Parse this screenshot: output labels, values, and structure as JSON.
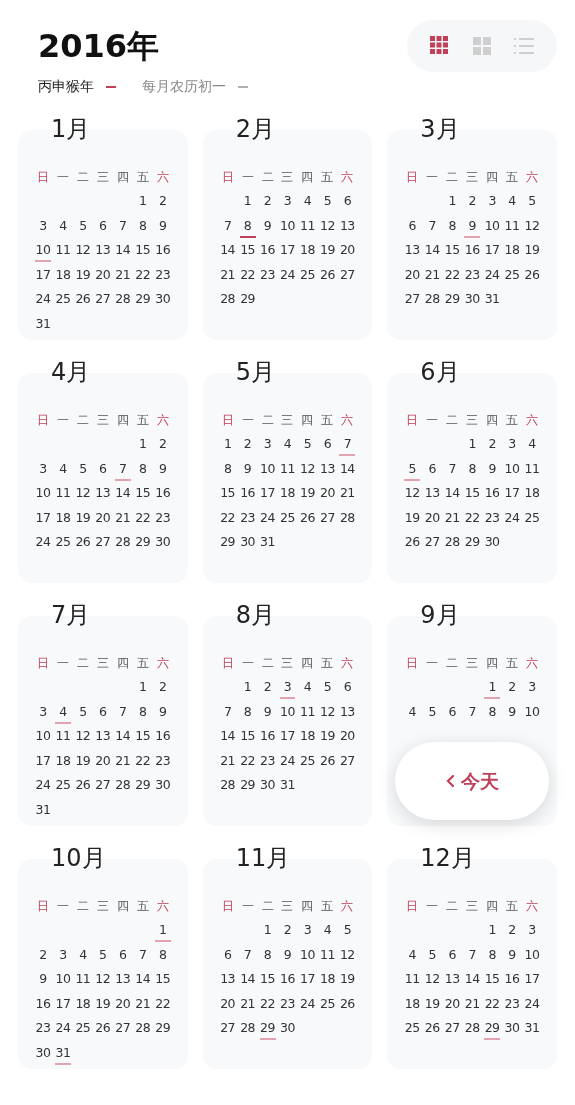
{
  "header": {
    "year": "2016年",
    "legend": [
      {
        "label": "丙申猴年",
        "color": "#c0405a"
      },
      {
        "label": "每月农历初一",
        "color": "#b0b0b0"
      }
    ]
  },
  "view_options": [
    {
      "kind": "month_grid",
      "selected": true
    },
    {
      "kind": "quad_grid",
      "selected": false
    },
    {
      "kind": "list",
      "selected": false
    }
  ],
  "months": [
    {
      "title": "1月",
      "weekdays": [
        {
          "label": "日",
          "weekend": true
        },
        {
          "label": "一",
          "weekend": false
        },
        {
          "label": "二",
          "weekend": false
        },
        {
          "label": "三",
          "weekend": false
        },
        {
          "label": "四",
          "weekend": false
        },
        {
          "label": "五",
          "weekend": false
        },
        {
          "label": "六",
          "weekend": true
        }
      ],
      "weeks": [
        {
          "kind": "first",
          "days": [
            "1",
            "2"
          ]
        },
        {
          "kind": "full",
          "days": [
            "3",
            "4",
            "5",
            "6",
            "7",
            "8",
            "9"
          ]
        },
        {
          "kind": "full",
          "days": [
            {
              "d": "10",
              "color": "#e3a3ae"
            },
            "11",
            "12",
            "13",
            "14",
            "15",
            "16"
          ]
        },
        {
          "kind": "full",
          "days": [
            "17",
            "18",
            "19",
            "20",
            "21",
            "22",
            "23"
          ]
        },
        {
          "kind": "full",
          "days": [
            "24",
            "25",
            "26",
            "27",
            "28",
            "29",
            "30"
          ]
        },
        {
          "kind": "last",
          "days": [
            "31"
          ]
        }
      ]
    },
    {
      "title": "2月",
      "weekdays": [
        {
          "label": "日",
          "weekend": true
        },
        {
          "label": "一",
          "weekend": false
        },
        {
          "label": "二",
          "weekend": false
        },
        {
          "label": "三",
          "weekend": false
        },
        {
          "label": "四",
          "weekend": false
        },
        {
          "label": "五",
          "weekend": false
        },
        {
          "label": "六",
          "weekend": true
        }
      ],
      "weeks": [
        {
          "kind": "first",
          "days": [
            "1",
            "2",
            "3",
            "4",
            "5",
            "6"
          ]
        },
        {
          "kind": "full",
          "days": [
            "7",
            {
              "d": "8",
              "color": "#c0405a"
            },
            "9",
            "10",
            "11",
            "12",
            "13"
          ]
        },
        {
          "kind": "full",
          "days": [
            "14",
            "15",
            "16",
            "17",
            "18",
            "19",
            "20"
          ]
        },
        {
          "kind": "full",
          "days": [
            "21",
            "22",
            "23",
            "24",
            "25",
            "26",
            "27"
          ]
        },
        {
          "kind": "last",
          "days": [
            "28",
            "29"
          ]
        }
      ]
    },
    {
      "title": "3月",
      "weekdays": [
        {
          "label": "日",
          "weekend": true
        },
        {
          "label": "一",
          "weekend": false
        },
        {
          "label": "二",
          "weekend": false
        },
        {
          "label": "三",
          "weekend": false
        },
        {
          "label": "四",
          "weekend": false
        },
        {
          "label": "五",
          "weekend": false
        },
        {
          "label": "六",
          "weekend": true
        }
      ],
      "weeks": [
        {
          "kind": "first",
          "days": [
            "1",
            "2",
            "3",
            "4",
            "5"
          ]
        },
        {
          "kind": "full",
          "days": [
            "6",
            "7",
            "8",
            {
              "d": "9",
              "color": "#e3a3ae"
            },
            "10",
            "11",
            "12"
          ]
        },
        {
          "kind": "full",
          "days": [
            "13",
            "14",
            "15",
            "16",
            "17",
            "18",
            "19"
          ]
        },
        {
          "kind": "full",
          "days": [
            "20",
            "21",
            "22",
            "23",
            "24",
            "25",
            "26"
          ]
        },
        {
          "kind": "last",
          "days": [
            "27",
            "28",
            "29",
            "30",
            "31"
          ]
        }
      ]
    },
    {
      "title": "4月",
      "weekdays": [
        {
          "label": "日",
          "weekend": true
        },
        {
          "label": "一",
          "weekend": false
        },
        {
          "label": "二",
          "weekend": false
        },
        {
          "label": "三",
          "weekend": false
        },
        {
          "label": "四",
          "weekend": false
        },
        {
          "label": "五",
          "weekend": false
        },
        {
          "label": "六",
          "weekend": true
        }
      ],
      "weeks": [
        {
          "kind": "first",
          "days": [
            "1",
            "2"
          ]
        },
        {
          "kind": "full",
          "days": [
            "3",
            "4",
            "5",
            "6",
            {
              "d": "7",
              "color": "#e3a3ae"
            },
            "8",
            "9"
          ]
        },
        {
          "kind": "full",
          "days": [
            "10",
            "11",
            "12",
            "13",
            "14",
            "15",
            "16"
          ]
        },
        {
          "kind": "full",
          "days": [
            "17",
            "18",
            "19",
            "20",
            "21",
            "22",
            "23"
          ]
        },
        {
          "kind": "full",
          "days": [
            "24",
            "25",
            "26",
            "27",
            "28",
            "29",
            "30"
          ]
        }
      ]
    },
    {
      "title": "5月",
      "weekdays": [
        {
          "label": "日",
          "weekend": true
        },
        {
          "label": "一",
          "weekend": false
        },
        {
          "label": "二",
          "weekend": false
        },
        {
          "label": "三",
          "weekend": false
        },
        {
          "label": "四",
          "weekend": false
        },
        {
          "label": "五",
          "weekend": false
        },
        {
          "label": "六",
          "weekend": true
        }
      ],
      "weeks": [
        {
          "kind": "full",
          "days": [
            "1",
            "2",
            "3",
            "4",
            "5",
            "6",
            {
              "d": "7",
              "color": "#e3a3ae"
            }
          ]
        },
        {
          "kind": "full",
          "days": [
            "8",
            "9",
            "10",
            "11",
            "12",
            "13",
            "14"
          ]
        },
        {
          "kind": "full",
          "days": [
            "15",
            "16",
            "17",
            "18",
            "19",
            "20",
            "21"
          ]
        },
        {
          "kind": "full",
          "days": [
            "22",
            "23",
            "24",
            "25",
            "26",
            "27",
            "28"
          ]
        },
        {
          "kind": "last",
          "days": [
            "29",
            "30",
            "31"
          ]
        }
      ]
    },
    {
      "title": "6月",
      "weekdays": [
        {
          "label": "日",
          "weekend": true
        },
        {
          "label": "一",
          "weekend": false
        },
        {
          "label": "二",
          "weekend": false
        },
        {
          "label": "三",
          "weekend": false
        },
        {
          "label": "四",
          "weekend": false
        },
        {
          "label": "五",
          "weekend": false
        },
        {
          "label": "六",
          "weekend": true
        }
      ],
      "weeks": [
        {
          "kind": "first",
          "days": [
            "1",
            "2",
            "3",
            "4"
          ]
        },
        {
          "kind": "full",
          "days": [
            {
              "d": "5",
              "color": "#e3a3ae"
            },
            "6",
            "7",
            "8",
            "9",
            "10",
            "11"
          ]
        },
        {
          "kind": "full",
          "days": [
            "12",
            "13",
            "14",
            "15",
            "16",
            "17",
            "18"
          ]
        },
        {
          "kind": "full",
          "days": [
            "19",
            "20",
            "21",
            "22",
            "23",
            "24",
            "25"
          ]
        },
        {
          "kind": "last",
          "days": [
            "26",
            "27",
            "28",
            "29",
            "30"
          ]
        }
      ]
    },
    {
      "title": "7月",
      "weekdays": [
        {
          "label": "日",
          "weekend": true
        },
        {
          "label": "一",
          "weekend": false
        },
        {
          "label": "二",
          "weekend": false
        },
        {
          "label": "三",
          "weekend": false
        },
        {
          "label": "四",
          "weekend": false
        },
        {
          "label": "五",
          "weekend": false
        },
        {
          "label": "六",
          "weekend": true
        }
      ],
      "weeks": [
        {
          "kind": "first",
          "days": [
            "1",
            "2"
          ]
        },
        {
          "kind": "full",
          "days": [
            "3",
            {
              "d": "4",
              "color": "#e3a3ae"
            },
            "5",
            "6",
            "7",
            "8",
            "9"
          ]
        },
        {
          "kind": "full",
          "days": [
            "10",
            "11",
            "12",
            "13",
            "14",
            "15",
            "16"
          ]
        },
        {
          "kind": "full",
          "days": [
            "17",
            "18",
            "19",
            "20",
            "21",
            "22",
            "23"
          ]
        },
        {
          "kind": "full",
          "days": [
            "24",
            "25",
            "26",
            "27",
            "28",
            "29",
            "30"
          ]
        },
        {
          "kind": "last",
          "days": [
            "31"
          ]
        }
      ]
    },
    {
      "title": "8月",
      "weekdays": [
        {
          "label": "日",
          "weekend": true
        },
        {
          "label": "一",
          "weekend": false
        },
        {
          "label": "二",
          "weekend": false
        },
        {
          "label": "三",
          "weekend": false
        },
        {
          "label": "四",
          "weekend": false
        },
        {
          "label": "五",
          "weekend": false
        },
        {
          "label": "六",
          "weekend": true
        }
      ],
      "weeks": [
        {
          "kind": "first",
          "days": [
            "1",
            "2",
            {
              "d": "3",
              "color": "#e3a3ae"
            },
            "4",
            "5",
            "6"
          ]
        },
        {
          "kind": "full",
          "days": [
            "7",
            "8",
            "9",
            "10",
            "11",
            "12",
            "13"
          ]
        },
        {
          "kind": "full",
          "days": [
            "14",
            "15",
            "16",
            "17",
            "18",
            "19",
            "20"
          ]
        },
        {
          "kind": "full",
          "days": [
            "21",
            "22",
            "23",
            "24",
            "25",
            "26",
            "27"
          ]
        },
        {
          "kind": "last",
          "days": [
            "28",
            "29",
            "30",
            "31"
          ]
        }
      ]
    },
    {
      "title": "9月",
      "weekdays": [
        {
          "label": "日",
          "weekend": true
        },
        {
          "label": "一",
          "weekend": false
        },
        {
          "label": "二",
          "weekend": false
        },
        {
          "label": "三",
          "weekend": false
        },
        {
          "label": "四",
          "weekend": false
        },
        {
          "label": "五",
          "weekend": false
        },
        {
          "label": "六",
          "weekend": true
        }
      ],
      "weeks": [
        {
          "kind": "first",
          "days": [
            {
              "d": "1",
              "color": "#e3a3ae"
            },
            "2",
            "3"
          ]
        },
        {
          "kind": "full",
          "days": [
            "4",
            "5",
            "6",
            "7",
            "8",
            "9",
            "10"
          ]
        }
      ]
    },
    {
      "title": "10月",
      "weekdays": [
        {
          "label": "日",
          "weekend": true
        },
        {
          "label": "一",
          "weekend": false
        },
        {
          "label": "二",
          "weekend": false
        },
        {
          "label": "三",
          "weekend": false
        },
        {
          "label": "四",
          "weekend": false
        },
        {
          "label": "五",
          "weekend": false
        },
        {
          "label": "六",
          "weekend": true
        }
      ],
      "weeks": [
        {
          "kind": "first",
          "days": [
            {
              "d": "1",
              "color": "#e3a3ae"
            }
          ]
        },
        {
          "kind": "full",
          "days": [
            "2",
            "3",
            "4",
            "5",
            "6",
            "7",
            "8"
          ]
        },
        {
          "kind": "full",
          "days": [
            "9",
            "10",
            "11",
            "12",
            "13",
            "14",
            "15"
          ]
        },
        {
          "kind": "full",
          "days": [
            "16",
            "17",
            "18",
            "19",
            "20",
            "21",
            "22"
          ]
        },
        {
          "kind": "full",
          "days": [
            "23",
            "24",
            "25",
            "26",
            "27",
            "28",
            "29"
          ]
        },
        {
          "kind": "last",
          "days": [
            "30",
            {
              "d": "31",
              "color": "#e3a3ae"
            }
          ]
        }
      ]
    },
    {
      "title": "11月",
      "weekdays": [
        {
          "label": "日",
          "weekend": true
        },
        {
          "label": "一",
          "weekend": false
        },
        {
          "label": "二",
          "weekend": false
        },
        {
          "label": "三",
          "weekend": false
        },
        {
          "label": "四",
          "weekend": false
        },
        {
          "label": "五",
          "weekend": false
        },
        {
          "label": "六",
          "weekend": true
        }
      ],
      "weeks": [
        {
          "kind": "first",
          "days": [
            "1",
            "2",
            "3",
            "4",
            "5"
          ]
        },
        {
          "kind": "full",
          "days": [
            "6",
            "7",
            "8",
            "9",
            "10",
            "11",
            "12"
          ]
        },
        {
          "kind": "full",
          "days": [
            "13",
            "14",
            "15",
            "16",
            "17",
            "18",
            "19"
          ]
        },
        {
          "kind": "full",
          "days": [
            "20",
            "21",
            "22",
            "23",
            "24",
            "25",
            "26"
          ]
        },
        {
          "kind": "last",
          "days": [
            "27",
            "28",
            {
              "d": "29",
              "color": "#e3a3ae"
            },
            "30"
          ]
        }
      ]
    },
    {
      "title": "12月",
      "weekdays": [
        {
          "label": "日",
          "weekend": true
        },
        {
          "label": "一",
          "weekend": false
        },
        {
          "label": "二",
          "weekend": false
        },
        {
          "label": "三",
          "weekend": false
        },
        {
          "label": "四",
          "weekend": false
        },
        {
          "label": "五",
          "weekend": false
        },
        {
          "label": "六",
          "weekend": true
        }
      ],
      "weeks": [
        {
          "kind": "first",
          "days": [
            "1",
            "2",
            "3"
          ]
        },
        {
          "kind": "full",
          "days": [
            "4",
            "5",
            "6",
            "7",
            "8",
            "9",
            "10"
          ]
        },
        {
          "kind": "full",
          "days": [
            "11",
            "12",
            "13",
            "14",
            "15",
            "16",
            "17"
          ]
        },
        {
          "kind": "full",
          "days": [
            "18",
            "19",
            "20",
            "21",
            "22",
            "23",
            "24"
          ]
        },
        {
          "kind": "full",
          "days": [
            "25",
            "26",
            "27",
            "28",
            {
              "d": "29",
              "color": "#e3a3ae"
            },
            "30",
            "31"
          ]
        }
      ]
    }
  ],
  "today_button": {
    "label": "今天"
  }
}
